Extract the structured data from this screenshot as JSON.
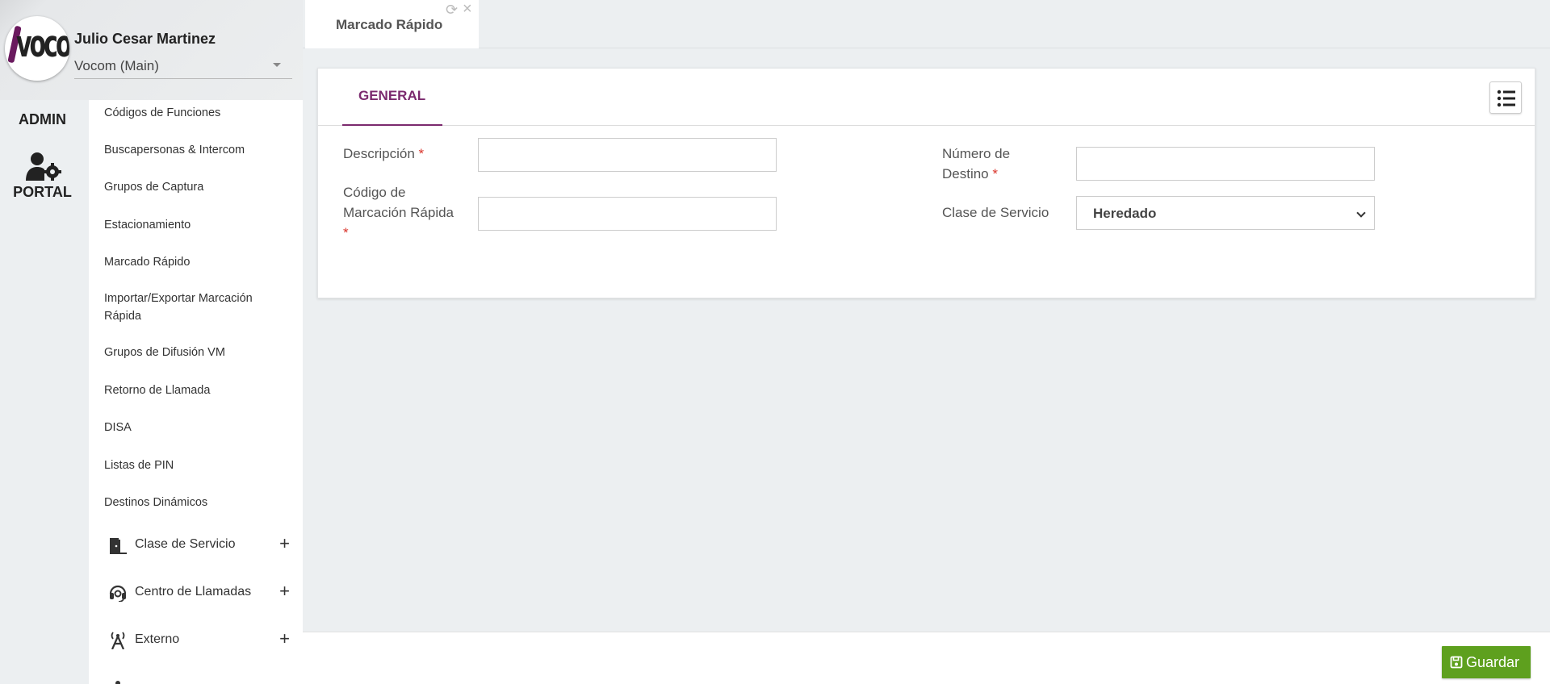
{
  "user": {
    "name": "Julio Cesar Martinez",
    "tenant": "Vocom (Main)"
  },
  "logo": {
    "text": "vocom"
  },
  "rail": {
    "admin": "ADMIN",
    "portal": "PORTAL"
  },
  "submenu": {
    "items": [
      "Códigos de Funciones",
      "Buscapersonas & Intercom",
      "Grupos de Captura",
      "Estacionamiento",
      "Marcado Rápido",
      "Importar/Exportar Marcación Rápida",
      "Grupos de Difusión VM",
      "Retorno de Llamada",
      "DISA",
      "Listas de PIN",
      "Destinos Dinámicos"
    ],
    "groups": [
      {
        "label": "Clase de Servicio",
        "icon": "door-icon"
      },
      {
        "label": "Centro de Llamadas",
        "icon": "headset-icon"
      },
      {
        "label": "Externo",
        "icon": "antenna-icon"
      }
    ],
    "expand_symbol": "+"
  },
  "tabbar": {
    "active_tab": "Marcado Rápido",
    "refresh_icon": "⟳",
    "close_icon": "×"
  },
  "card": {
    "tab_general": "GENERAL"
  },
  "form": {
    "descripcion_label": "Descripción",
    "codigo_label_line1": "Código de",
    "codigo_label_line2": "Marcación Rápida",
    "numero_label_line1": "Número de",
    "numero_label_line2": "Destino",
    "clase_label": "Clase de Servicio",
    "clase_value": "Heredado",
    "required_mark": "*",
    "descripcion_value": "",
    "codigo_value": "",
    "numero_value": ""
  },
  "footer": {
    "save_label": "Guardar"
  },
  "colors": {
    "accent": "#7b2a6e",
    "save": "#5ea01e",
    "required": "#d9342b"
  }
}
